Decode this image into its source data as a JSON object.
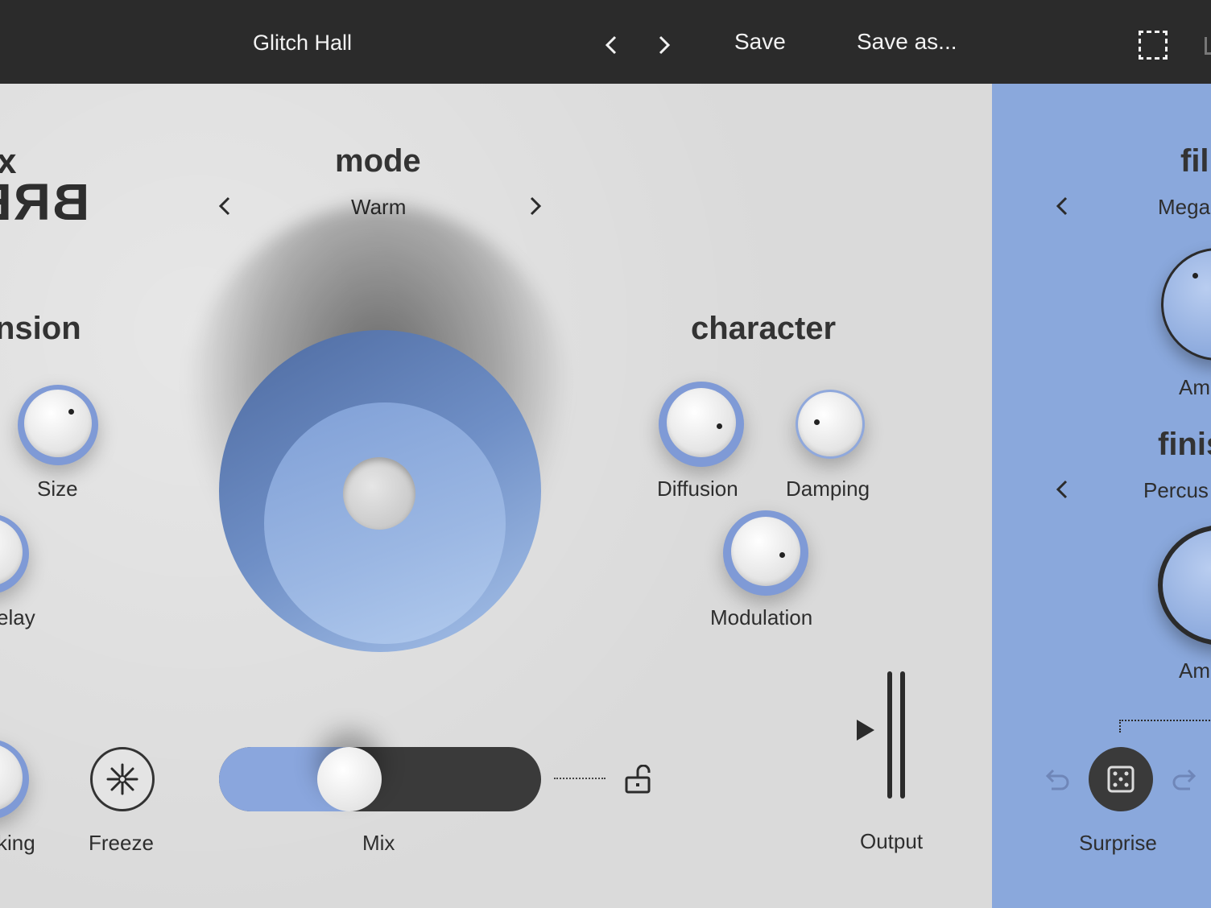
{
  "topbar": {
    "preset_name": "Glitch Hall",
    "save_label": "Save",
    "saveas_label": "Save as..."
  },
  "logo": {
    "x_mark": "x",
    "word": "BRE"
  },
  "sections": {
    "mode": {
      "title": "mode",
      "value": "Warm"
    },
    "dimension": {
      "title": "nsion"
    },
    "character": {
      "title": "character"
    }
  },
  "knobs": {
    "size": "Size",
    "delay": "elay",
    "king": "king",
    "diffusion": "Diffusion",
    "damping": "Damping",
    "modulation": "Modulation"
  },
  "controls": {
    "freeze": "Freeze",
    "mix": "Mix",
    "mix_value": 0.38,
    "output": "Output"
  },
  "side": {
    "filter_title": "fil",
    "filter_value": "Mega",
    "amount_label_1": "Am",
    "finish_title": "finis",
    "finish_value": "Percus",
    "amount_label_2": "Am",
    "surprise": "Surprise"
  },
  "colors": {
    "accent_blue": "#8aa8dc",
    "dark": "#2b2b2b",
    "panel": "#dadada"
  }
}
